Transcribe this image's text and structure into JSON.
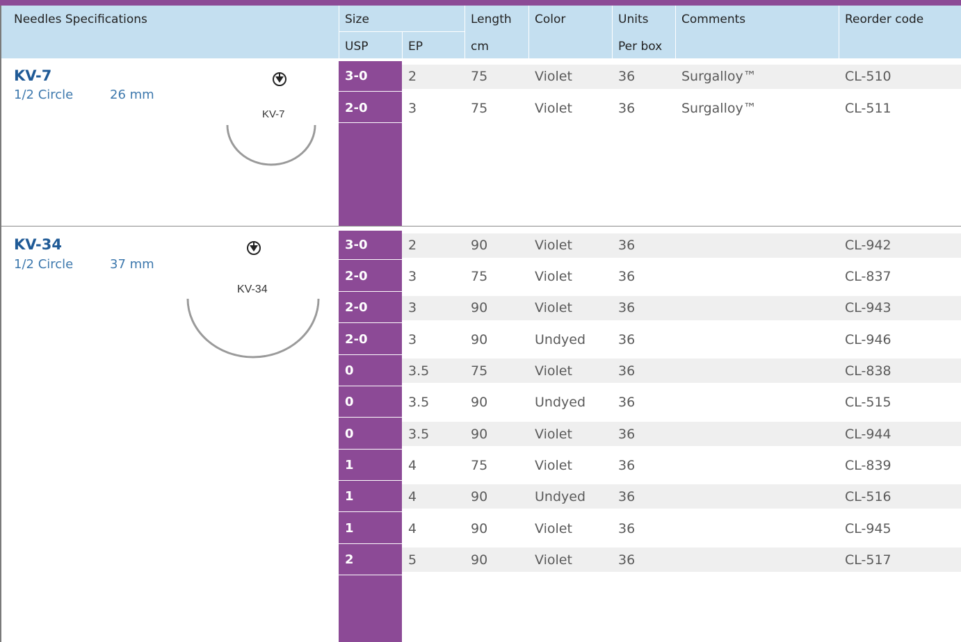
{
  "header": {
    "needles_specifications": "Needles Specifications",
    "size": "Size",
    "usp": "USP",
    "ep": "EP",
    "length": "Length",
    "cm": "cm",
    "color": "Color",
    "units": "Units",
    "per_box": "Per box",
    "comments": "Comments",
    "reorder_code": "Reorder code"
  },
  "groups": [
    {
      "name": "KV-7",
      "shape": "1/2 Circle",
      "size": "26 mm",
      "figure_label": "KV-7",
      "rows": [
        {
          "usp": "3-0",
          "ep": "2",
          "length": "75",
          "color": "Violet",
          "units": "36",
          "comments": "Surgalloy™",
          "code": "CL-510"
        },
        {
          "usp": "2-0",
          "ep": "3",
          "length": "75",
          "color": "Violet",
          "units": "36",
          "comments": "Surgalloy™",
          "code": "CL-511"
        }
      ]
    },
    {
      "name": "KV-34",
      "shape": "1/2 Circle",
      "size": "37 mm",
      "figure_label": "KV-34",
      "rows": [
        {
          "usp": "3-0",
          "ep": "2",
          "length": "90",
          "color": "Violet",
          "units": "36",
          "comments": "",
          "code": "CL-942"
        },
        {
          "usp": "2-0",
          "ep": "3",
          "length": "75",
          "color": "Violet",
          "units": "36",
          "comments": "",
          "code": "CL-837"
        },
        {
          "usp": "2-0",
          "ep": "3",
          "length": "90",
          "color": "Violet",
          "units": "36",
          "comments": "",
          "code": "CL-943"
        },
        {
          "usp": "2-0",
          "ep": "3",
          "length": "90",
          "color": "Undyed",
          "units": "36",
          "comments": "",
          "code": "CL-946"
        },
        {
          "usp": "0",
          "ep": "3.5",
          "length": "75",
          "color": "Violet",
          "units": "36",
          "comments": "",
          "code": "CL-838"
        },
        {
          "usp": "0",
          "ep": "3.5",
          "length": "90",
          "color": "Undyed",
          "units": "36",
          "comments": "",
          "code": "CL-515"
        },
        {
          "usp": "0",
          "ep": "3.5",
          "length": "90",
          "color": "Violet",
          "units": "36",
          "comments": "",
          "code": "CL-944"
        },
        {
          "usp": "1",
          "ep": "4",
          "length": "75",
          "color": "Violet",
          "units": "36",
          "comments": "",
          "code": "CL-839"
        },
        {
          "usp": "1",
          "ep": "4",
          "length": "90",
          "color": "Undyed",
          "units": "36",
          "comments": "",
          "code": "CL-516"
        },
        {
          "usp": "1",
          "ep": "4",
          "length": "90",
          "color": "Violet",
          "units": "36",
          "comments": "",
          "code": "CL-945"
        },
        {
          "usp": "2",
          "ep": "5",
          "length": "90",
          "color": "Violet",
          "units": "36",
          "comments": "",
          "code": "CL-517"
        }
      ]
    }
  ],
  "colors": {
    "accent_purple": "#8c4a96",
    "header_blue": "#c4dff0",
    "row_stripe": "#efefef",
    "needle_name_blue": "#1f5a96"
  },
  "icons": {
    "needle_cross_section": "triangle-in-circle-icon"
  }
}
